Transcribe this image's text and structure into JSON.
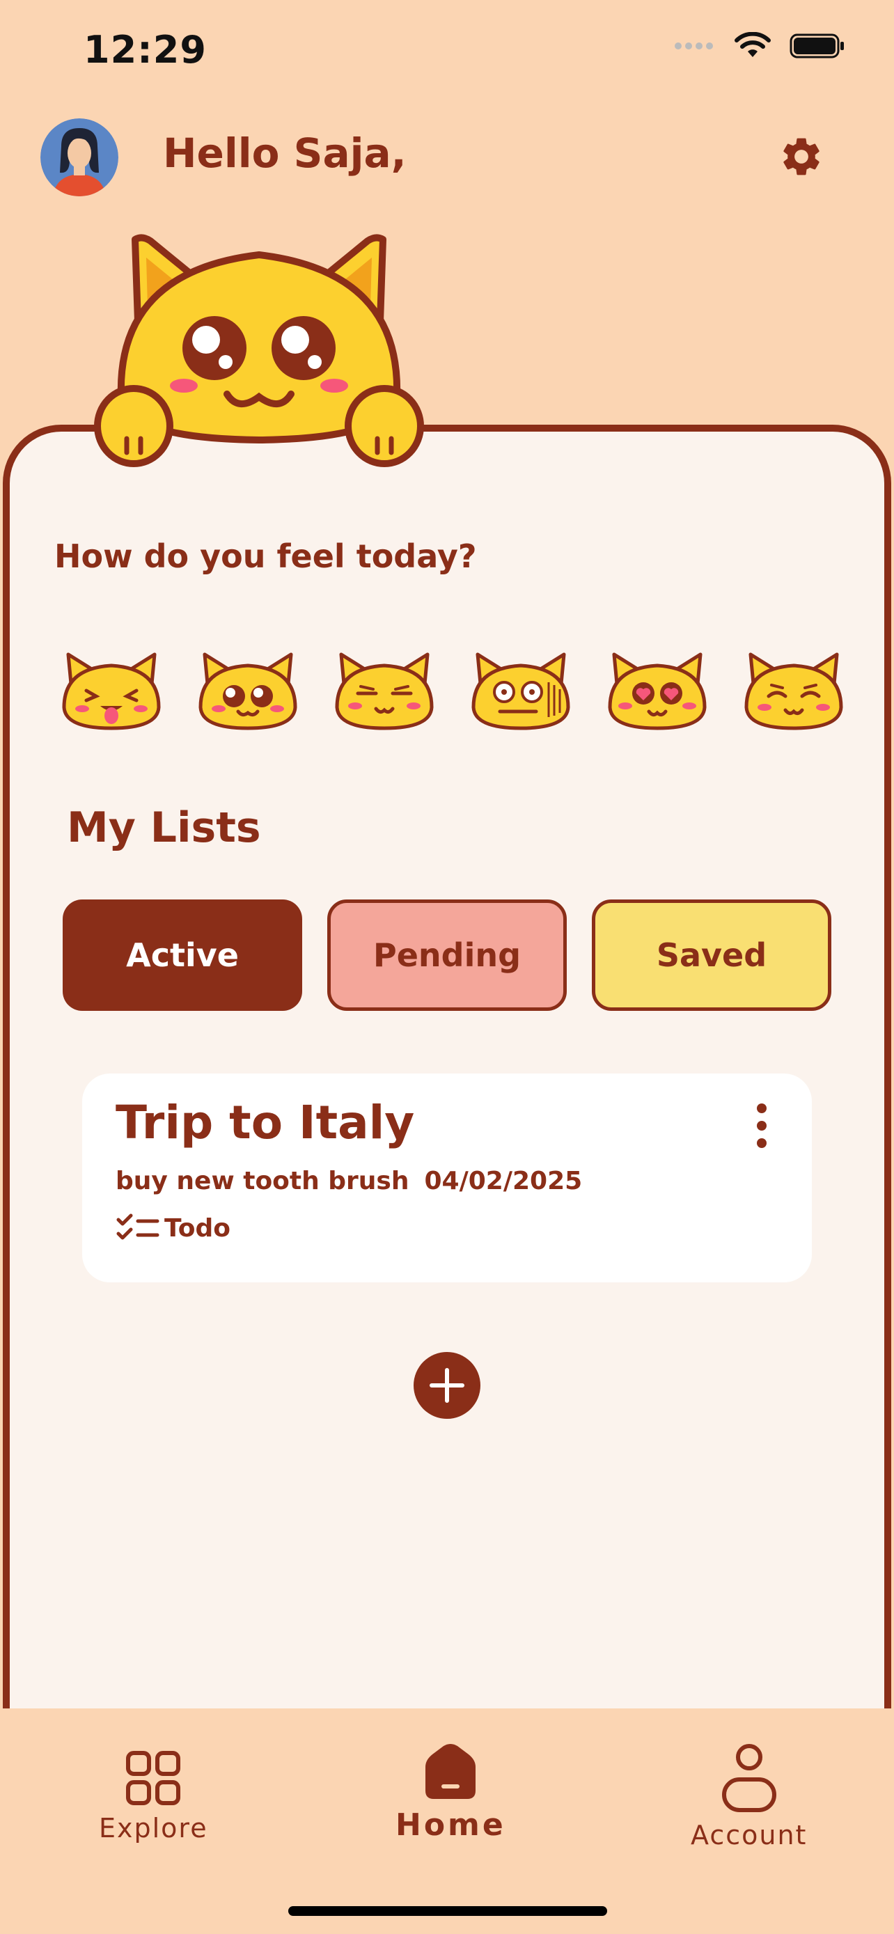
{
  "status_bar": {
    "time": "12:29"
  },
  "header": {
    "greeting": "Hello Saja,",
    "avatar_icon": "user-avatar",
    "settings_icon": "gear-icon"
  },
  "mood": {
    "question": "How do you feel today?",
    "emojis": [
      "cat-tongue",
      "cat-starry-eyes",
      "cat-smug",
      "cat-shocked",
      "cat-heart-eyes",
      "cat-pleased"
    ]
  },
  "lists": {
    "title": "My Lists",
    "tabs": [
      {
        "label": "Active"
      },
      {
        "label": "Pending"
      },
      {
        "label": "Saved"
      }
    ],
    "items": [
      {
        "title": "Trip to Italy",
        "subtitle": "buy new tooth brush",
        "date": "04/02/2025",
        "type": "Todo"
      }
    ]
  },
  "nav": {
    "explore": "Explore",
    "home": "Home",
    "account": "Account"
  },
  "colors": {
    "background": "#fbd5b3",
    "accent": "#8a2e18",
    "panel": "#fbf3ed",
    "pending": "#f4a69a",
    "saved": "#f9df72",
    "cat": "#fcd02f"
  }
}
